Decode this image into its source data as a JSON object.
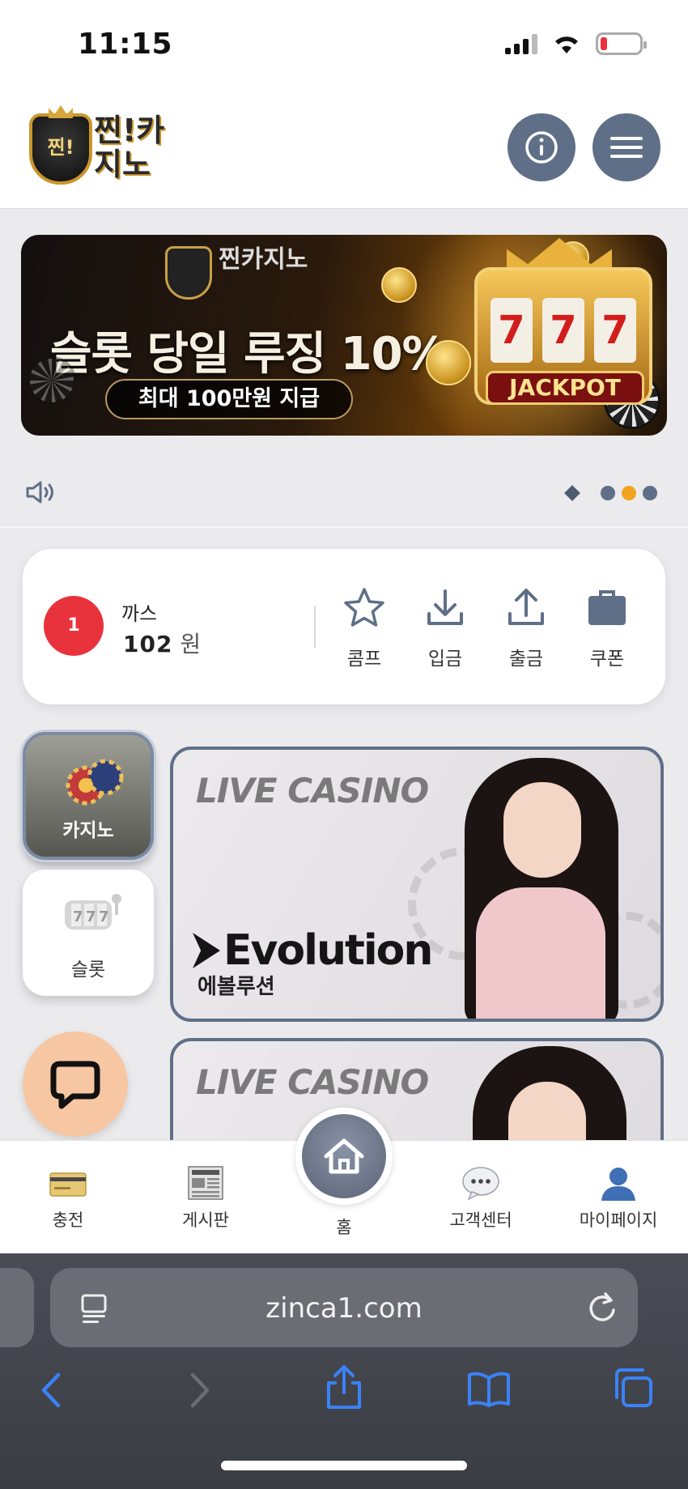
{
  "status_bar": {
    "time": "11:15"
  },
  "header": {
    "logo_text": "찐!카지노",
    "logo_badge": "찐!"
  },
  "banner": {
    "logo_text": "찐카지노",
    "title": "슬롯 당일 루징 10%",
    "subtitle": "최대 100만원 지급",
    "slot_reels": [
      "7",
      "7",
      "7"
    ],
    "jackpot": "JACKPOT",
    "active_slide": 2,
    "slide_count": 3
  },
  "user": {
    "rank": "1",
    "name": "까스",
    "balance": "102",
    "currency": "원",
    "actions": [
      {
        "label": "콤프",
        "icon": "star-icon"
      },
      {
        "label": "입금",
        "icon": "download-icon"
      },
      {
        "label": "출금",
        "icon": "upload-icon"
      },
      {
        "label": "쿠폰",
        "icon": "briefcase-icon"
      }
    ]
  },
  "categories": [
    {
      "label": "카지노",
      "active": true
    },
    {
      "label": "슬롯",
      "active": false
    }
  ],
  "games": [
    {
      "title": "LIVE CASINO",
      "provider": "Evolution",
      "provider_kor": "에볼루션"
    },
    {
      "title": "LIVE CASINO"
    }
  ],
  "bottom_nav": {
    "items": [
      {
        "label": "충전",
        "icon": "card-icon"
      },
      {
        "label": "게시판",
        "icon": "newspaper-icon"
      },
      {
        "label": "홈",
        "icon": "home-icon"
      },
      {
        "label": "고객센터",
        "icon": "chat-bubble-icon"
      },
      {
        "label": "마이페이지",
        "icon": "user-icon"
      }
    ]
  },
  "browser": {
    "url": "zinca1.com"
  },
  "colors": {
    "accent": "#5f6f87",
    "rank_red": "#e8333c",
    "dot_active": "#f0a421",
    "ios_blue": "#3a82f7"
  }
}
